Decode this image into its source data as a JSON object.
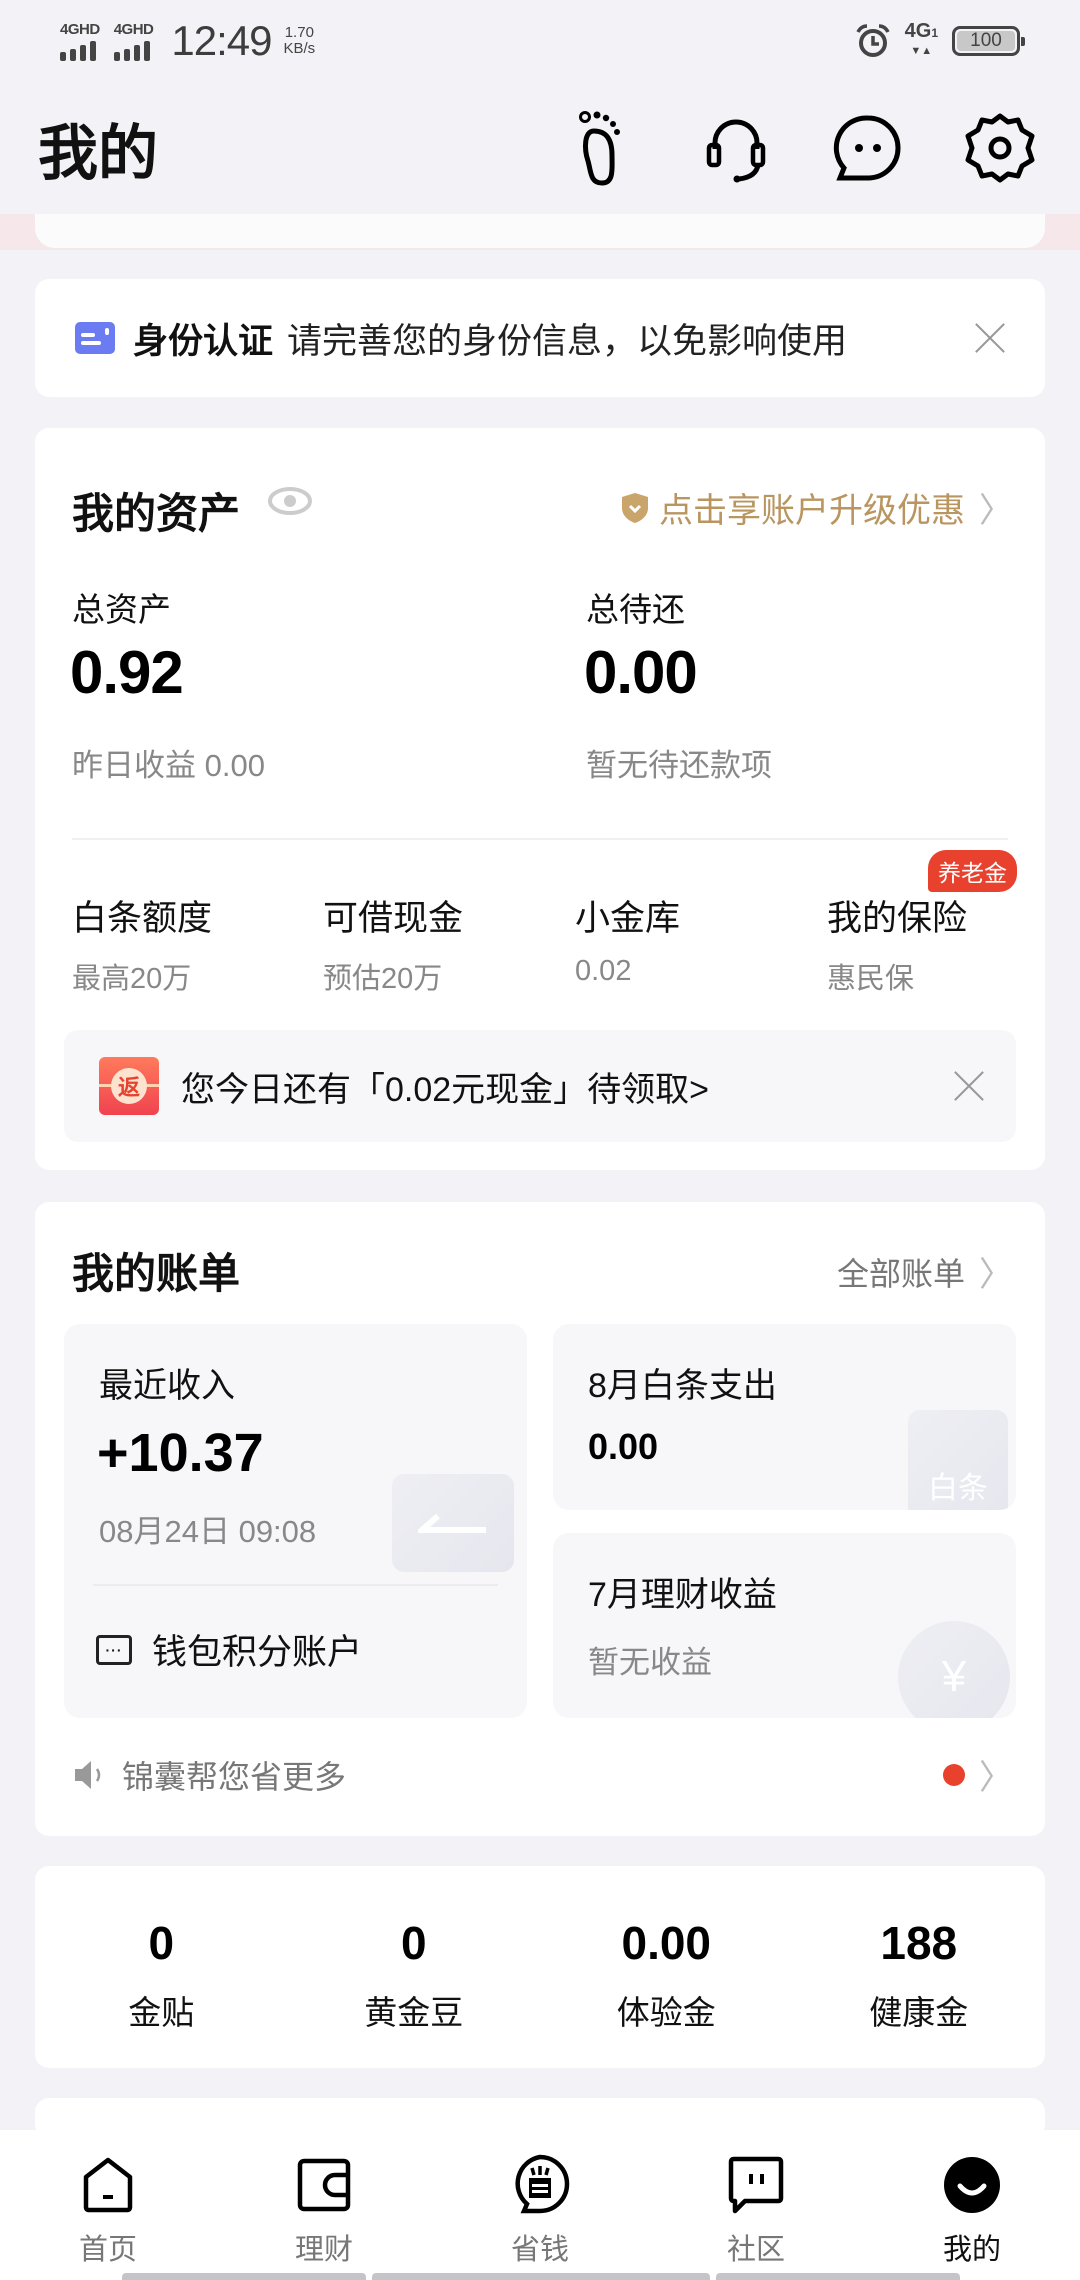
{
  "status_bar": {
    "sim1": "4GHD",
    "sim2": "4GHD",
    "time": "12:49",
    "speed_value": "1.70",
    "speed_unit": "KB/s",
    "network": "4G",
    "network_sub": "1",
    "battery": "100",
    "icons": [
      "signal-icon",
      "signal-icon",
      "alarm-icon",
      "battery-icon"
    ]
  },
  "header": {
    "title": "我的",
    "icons": [
      "footprint-icon",
      "customer-service-icon",
      "message-icon",
      "settings-icon"
    ]
  },
  "identity_banner": {
    "icon": "id-card-icon",
    "title": "身份认证",
    "description": "请完善您的身份信息，以免影响使用"
  },
  "assets": {
    "title": "我的资产",
    "eye_icon": "eye-icon",
    "upgrade_link": "点击享账户升级优惠",
    "accent_color": "#b99560",
    "total_assets": {
      "label": "总资产",
      "value": "0.92",
      "sub": "昨日收益 0.00"
    },
    "total_due": {
      "label": "总待还",
      "value": "0.00",
      "sub": "暂无待还款项"
    },
    "items": [
      {
        "title": "白条额度",
        "sub": "最高20万"
      },
      {
        "title": "可借现金",
        "sub": "预估20万"
      },
      {
        "title": "小金库",
        "sub": "0.02"
      },
      {
        "title": "我的保险",
        "sub": "惠民保",
        "badge": "养老金"
      }
    ],
    "cash_banner": {
      "icon_text": "返",
      "text": "您今日还有「0.02元现金」待领取>"
    }
  },
  "bills": {
    "title": "我的账单",
    "all_link": "全部账单",
    "recent_income": {
      "label": "最近收入",
      "value": "+10.37",
      "time": "08月24日 09:08"
    },
    "wallet_points": "钱包积分账户",
    "baitiao": {
      "label": "8月白条支出",
      "value": "0.00",
      "deco": "白条"
    },
    "finance": {
      "label": "7月理财收益",
      "sub": "暂无收益",
      "deco": "¥"
    },
    "tip": "锦囊帮您省更多"
  },
  "coins": [
    {
      "value": "0",
      "label": "金贴"
    },
    {
      "value": "0",
      "label": "黄金豆"
    },
    {
      "value": "0.00",
      "label": "体验金"
    },
    {
      "value": "188",
      "label": "健康金"
    }
  ],
  "tabbar": {
    "active": "我的",
    "tabs": [
      {
        "label": "首页",
        "icon": "home-icon"
      },
      {
        "label": "理财",
        "icon": "wallet-icon"
      },
      {
        "label": "省钱",
        "icon": "save-money-icon"
      },
      {
        "label": "社区",
        "icon": "community-icon"
      },
      {
        "label": "我的",
        "icon": "profile-icon"
      }
    ]
  },
  "colors": {
    "background": "#f3f3f7",
    "red": "#e8422f",
    "gold": "#b99560",
    "id_blue": "#6b7bf2"
  }
}
